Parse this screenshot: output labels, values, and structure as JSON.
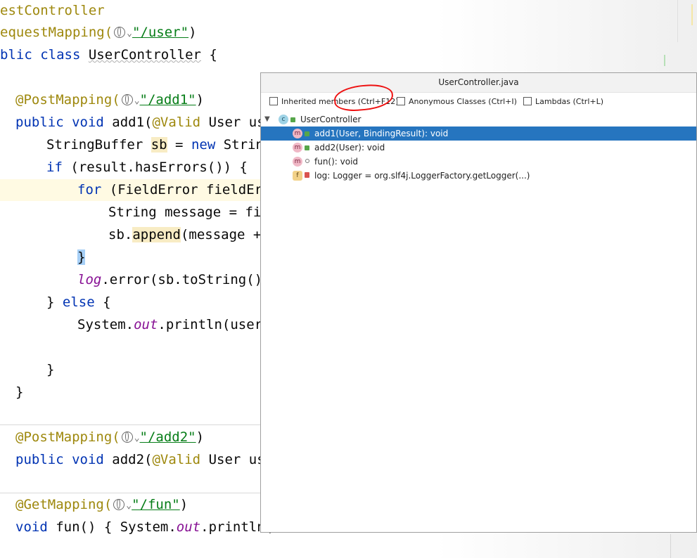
{
  "editor": {
    "lines": {
      "l1_text": "estController",
      "l2_prefix": "equestMapping(",
      "l2_str": "\"/user\"",
      "l2_close": ")",
      "l3_kw": "blic class ",
      "l3_name": "UserController",
      "l3_rest": " {",
      "l5_ann": "@PostMapping(",
      "l5_str": "\"/add1\"",
      "l5_close": ")",
      "l6_kw": "public void ",
      "l6_name": "add1(",
      "l6_ann": "@Valid",
      "l6_rest": " User use",
      "l7_a": "StringBuffer ",
      "l7_var": "sb",
      "l7_b": " = ",
      "l7_kw": "new",
      "l7_c": " String",
      "l8_kw": "if",
      "l8_rest": " (result.hasErrors()) {",
      "l9_kw": "for",
      "l9_rest": " (FieldError fieldErr",
      "l10_text": "String message = fie",
      "l11_a": "sb.",
      "l11_call": "append",
      "l11_b": "(message +",
      "l12_brace": "}",
      "l13_fld": "log",
      "l13_rest": ".error(sb.toString()",
      "l14_a": "} ",
      "l14_kw": "else",
      "l14_b": " {",
      "l15_a": "System.",
      "l15_fld": "out",
      "l15_b": ".println(user)",
      "l17_brace": "}",
      "l18_brace": "}",
      "l20_ann": "@PostMapping(",
      "l20_str": "\"/add2\"",
      "l20_close": ")",
      "l21_kw": "public void ",
      "l21_name": "add2(",
      "l21_ann": "@Valid",
      "l21_rest": " User use",
      "l23_ann": "@GetMapping(",
      "l23_str": "\"/fun\"",
      "l23_close": ")",
      "l24_kw": "void ",
      "l24_a": "fun() { System.",
      "l24_fld": "out",
      "l24_b": ".println("
    }
  },
  "popup": {
    "title": "UserController.java",
    "filters": [
      {
        "label": "Inherited members (Ctrl+F12)",
        "checked": false
      },
      {
        "label": "Anonymous Classes (Ctrl+I)",
        "checked": false
      },
      {
        "label": "Lambdas (Ctrl+L)",
        "checked": false
      }
    ],
    "tree": {
      "root_label": "UserController",
      "root_icon": "c",
      "items": [
        {
          "label": "add1(User, BindingResult): void",
          "icon": "m",
          "visibility": "public",
          "selected": true
        },
        {
          "label": "add2(User): void",
          "icon": "m",
          "visibility": "public",
          "selected": false
        },
        {
          "label": "fun(): void",
          "icon": "m",
          "visibility": "package-private",
          "selected": false
        },
        {
          "label": "log: Logger = org.slf4j.LoggerFactory.getLogger(...)",
          "icon": "f",
          "visibility": "private",
          "selected": false
        }
      ]
    }
  },
  "colors": {
    "selection": "#2675bf",
    "keyword": "#0033b3",
    "annotation": "#9e880d",
    "string": "#067d17",
    "static_field": "#871094",
    "annotation_circle": "#ee1111"
  }
}
